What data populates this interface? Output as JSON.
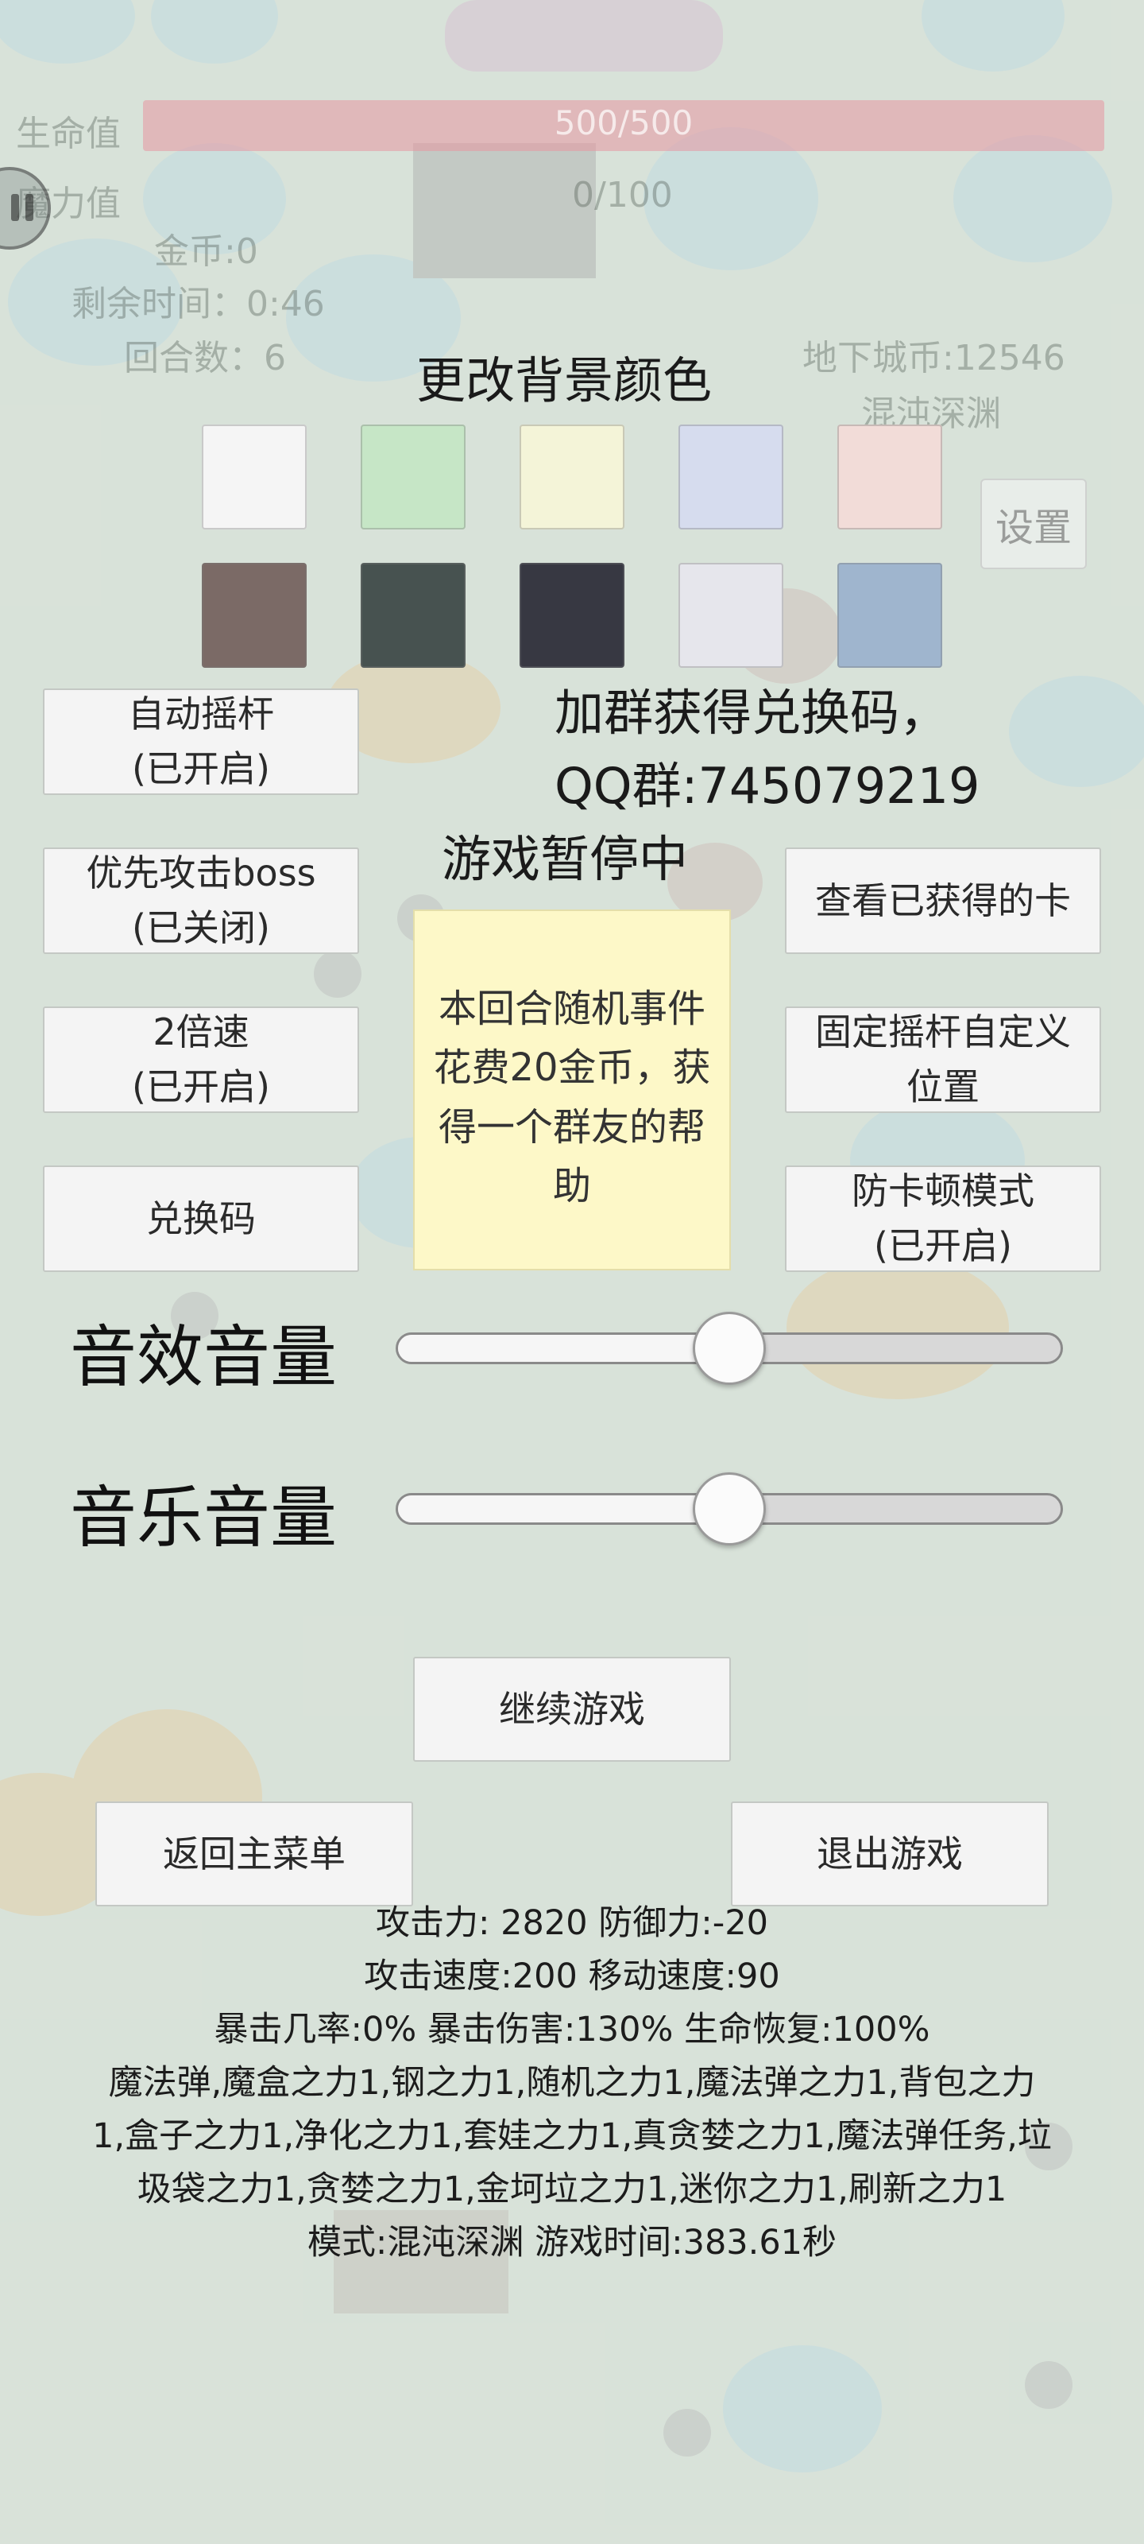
{
  "hud": {
    "hp_label": "生命值",
    "hp_value": "500/500",
    "mana_label": "魔力值",
    "mana_value": "0/100",
    "gold": "金币:0",
    "time_left": "剩余时间：0:46",
    "round": "回合数：6",
    "dungeon_coins": "地下城币:12546",
    "mode_name": "混沌深渊",
    "settings_label": "设置"
  },
  "background_color": {
    "title": "更改背景颜色",
    "swatches": [
      "#f5f5f5",
      "#c6e6c6",
      "#f4f4d8",
      "#d6dcee",
      "#f2dcd8",
      "#7b6a66",
      "#475250",
      "#373842",
      "#e6e6ec",
      "#9fb5ce"
    ]
  },
  "group_info": {
    "line1": "加群获得兑换码，",
    "line2": "QQ群:745079219"
  },
  "paused_title": "游戏暂停中",
  "left_buttons": {
    "auto_joystick": [
      "自动摇杆",
      "(已开启)"
    ],
    "prioritize_boss": [
      "优先攻击boss",
      "(已关闭)"
    ],
    "double_speed": [
      "2倍速",
      "(已开启)"
    ],
    "redeem_code": [
      "兑换码"
    ]
  },
  "right_buttons": {
    "view_cards": [
      "查看已获得的卡"
    ],
    "fixed_joystick": [
      "固定摇杆自定义",
      "位置"
    ],
    "anti_lag": [
      "防卡顿模式",
      "(已开启)"
    ]
  },
  "event_card": {
    "text": "本回合随机事件花费20金币，获得一个群友的帮助"
  },
  "volume": {
    "sfx_label": "音效音量",
    "sfx_level": 0.5,
    "music_label": "音乐音量",
    "music_level": 0.5
  },
  "actions": {
    "continue": "继续游戏",
    "main_menu": "返回主菜单",
    "quit": "退出游戏"
  },
  "stats": {
    "line1": "攻击力: 2820 防御力:-20",
    "line2": "攻击速度:200 移动速度:90",
    "line3": "暴击几率:0% 暴击伤害:130% 生命恢复:100%",
    "line4": "魔法弹,魔盒之力1,钢之力1,随机之力1,魔法弹之力1,背包之力",
    "line5": "1,盒子之力1,净化之力1,套娃之力1,真贪婪之力1,魔法弹任务,垃",
    "line6": "圾袋之力1,贪婪之力1,金坷垃之力1,迷你之力1,刷新之力1",
    "line7": "模式:混沌深渊 游戏时间:383.61秒"
  }
}
